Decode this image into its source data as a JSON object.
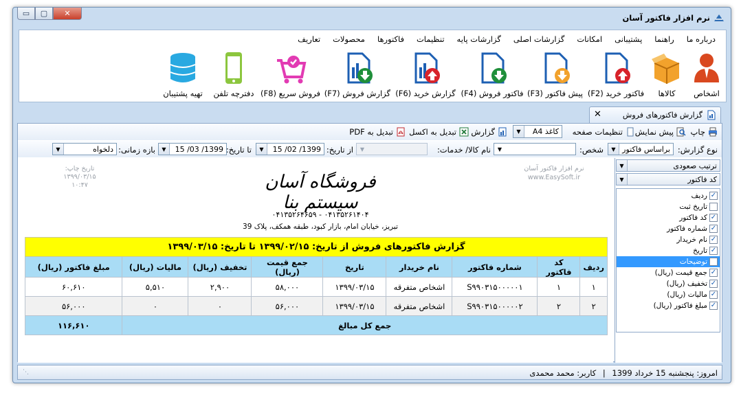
{
  "window": {
    "title": "نرم افزار فاکتور آسان",
    "controls": {
      "min": "▭",
      "max": "▢",
      "close": "✕"
    }
  },
  "menu": [
    "تعاریف",
    "محصولات",
    "فاکتورها",
    "تنظیمات",
    "گزارشات پایه",
    "گزارشات اصلی",
    "امکانات",
    "پشتیبانی",
    "راهنما",
    "درباره ما"
  ],
  "toolbar_buttons": [
    {
      "label": "اشخاص",
      "icon": "person-icon"
    },
    {
      "label": "کالاها",
      "icon": "box-icon"
    },
    {
      "label": "فاکتور خرید (F2)",
      "icon": "document-up-icon"
    },
    {
      "label": "پیش فاکتور (F3)",
      "icon": "document-down-orange-icon"
    },
    {
      "label": "فاکتور فروش (F4)",
      "icon": "document-down-green-icon"
    },
    {
      "label": "گزارش خرید (F6)",
      "icon": "chart-up-icon"
    },
    {
      "label": "گزارش فروش (F7)",
      "icon": "chart-down-icon"
    },
    {
      "label": "فروش سریع (F8)",
      "icon": "cart-icon"
    },
    {
      "label": "دفترچه تلفن",
      "icon": "phone-icon"
    },
    {
      "label": "تهیه پشتیبان",
      "icon": "database-icon"
    }
  ],
  "doc_tab": {
    "label": "گزارش فاکتورهای فروش",
    "close": "✕"
  },
  "report_toolbar": {
    "print": "چاپ",
    "preview": "پیش نمایش",
    "page_settings": "تنظیمات صفحه",
    "paper": "کاغذ A4",
    "report": "گزارش",
    "to_excel": "تبدیل به اکسل",
    "to_pdf": "تبدیل به PDF"
  },
  "filters": {
    "report_type_label": "نوع گزارش:",
    "report_type_value": "براساس فاکتور",
    "person_label": "شخص:",
    "person_value": "",
    "product_label": "نام کالا/ خدمات:",
    "product_value": "",
    "from_date_label": "از تاریخ:",
    "from_date_value": "1399/ 02/ 15",
    "to_date_label": "تا تاریخ:",
    "to_date_value": "1399/ 03/ 15",
    "range_label": "بازه زمانی:",
    "range_value": "دلخواه"
  },
  "side_panel": {
    "sort_order": "ترتیب صعودی",
    "sort_field": "کد فاکتور",
    "columns": [
      {
        "label": "ردیف",
        "checked": true,
        "selected": false
      },
      {
        "label": "تاریخ ثبت",
        "checked": false,
        "selected": false
      },
      {
        "label": "کد فاکتور",
        "checked": true,
        "selected": false
      },
      {
        "label": "شماره فاکتور",
        "checked": true,
        "selected": false
      },
      {
        "label": "نام خریدار",
        "checked": true,
        "selected": false
      },
      {
        "label": "تاریخ",
        "checked": true,
        "selected": false
      },
      {
        "label": "توضیحات",
        "checked": false,
        "selected": true
      },
      {
        "label": "جمع قیمت (ریال)",
        "checked": true,
        "selected": false
      },
      {
        "label": "تخفیف (ریال)",
        "checked": true,
        "selected": false
      },
      {
        "label": "مالیات (ریال)",
        "checked": true,
        "selected": false
      },
      {
        "label": "مبلغ فاکتور (ریال)",
        "checked": true,
        "selected": false
      }
    ]
  },
  "report": {
    "shop_name": "فروشگاه آسان سیستم بنا",
    "phones": "۰۴۱۳۵۲۶۱۴۰۴ - ۰۴۱۳۵۲۶۴۶۵۹",
    "address": "تبریز، خیابان امام، بازار کبود، طبقه همکف، پلاک 39",
    "software_name": "نرم افزار فاکتور آسان",
    "software_url": "www.EasySoft.ir",
    "print_date_label": "تاریخ چاپ:",
    "print_date": "۱۳۹۹/۰۳/۱۵",
    "print_time": "۱۰:۴۷",
    "heading": "گزارش فاکتورهای فروش از تاریخ: ۱۳۹۹/۰۲/۱۵ تا تاریخ: ۱۳۹۹/۰۳/۱۵",
    "columns": [
      "ردیف",
      "کد فاکتور",
      "شماره فاکتور",
      "نام خریدار",
      "تاریخ",
      "جمع قیمت (ریال)",
      "تخفیف (ریال)",
      "مالیات (ریال)",
      "مبلغ فاکتور (ریال)"
    ],
    "rows": [
      [
        "۱",
        "۱",
        "S۹۹۰۳۱۵۰۰۰۰۰۱",
        "اشخاص متفرقه",
        "۱۳۹۹/۰۳/۱۵",
        "۵۸,۰۰۰",
        "۲,۹۰۰",
        "۵,۵۱۰",
        "۶۰,۶۱۰"
      ],
      [
        "۲",
        "۲",
        "S۹۹۰۳۱۵۰۰۰۰۰۲",
        "اشخاص متفرقه",
        "۱۳۹۹/۰۳/۱۵",
        "۵۶,۰۰۰",
        "۰",
        "۰",
        "۵۶,۰۰۰"
      ]
    ],
    "total_label": "جمع کل مبالغ",
    "total_value": "۱۱۶,۶۱۰"
  },
  "status": {
    "today": "امروز: پنجشنبه 15 خرداد 1399",
    "separator": "|",
    "user": "کاربر: محمد محمدی"
  }
}
